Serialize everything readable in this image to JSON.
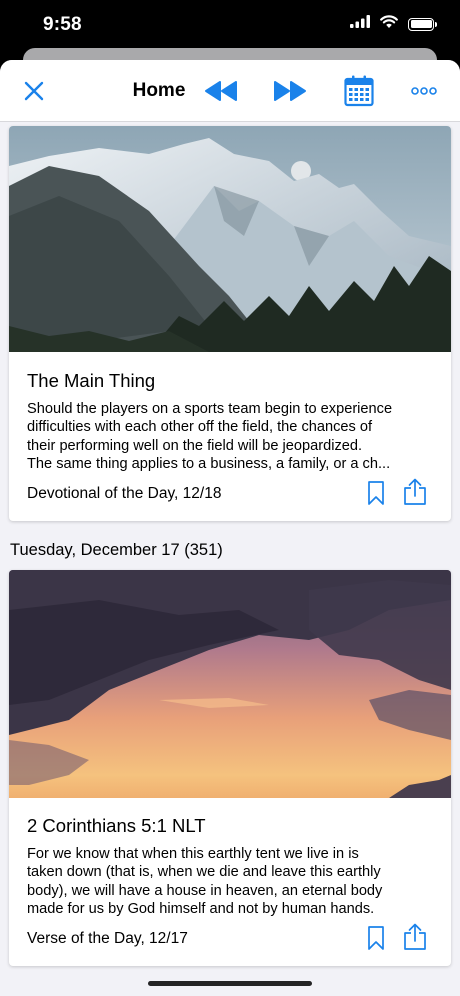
{
  "status_bar": {
    "time": "9:58"
  },
  "nav": {
    "title": "Home",
    "icons": [
      "close-icon",
      "rewind-icon",
      "fast-forward-icon",
      "calendar-icon",
      "more-icon"
    ]
  },
  "colors": {
    "accent": "#1a82ea",
    "background": "#f2f2f7"
  },
  "cards": [
    {
      "title": "The Main Thing",
      "text_lines": [
        "Should the players on a sports team begin to experience",
        "difficulties with each other off the field, the chances of",
        "their performing well on the field will be jeopardized.",
        "The same thing applies to a business, a family, or a ch..."
      ],
      "footer": "Devotional of the Day, 12/18"
    },
    {
      "section_header": "Tuesday, December 17 (351)",
      "title": "2 Corinthians 5:1 NLT",
      "text_lines": [
        "For we know that when this earthly tent we live in is",
        "taken down (that is, when we die and leave this earthly",
        "body), we will have a house in heaven, an eternal body",
        "made for us by God himself and not by human hands."
      ],
      "footer": "Verse of the Day, 12/17"
    }
  ]
}
